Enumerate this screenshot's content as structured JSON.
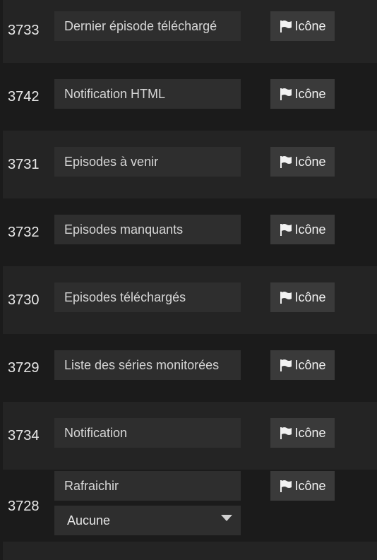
{
  "button_label": "Icône",
  "rows": [
    {
      "id": "3733",
      "name": "Dernier épisode téléchargé"
    },
    {
      "id": "3742",
      "name": "Notification HTML"
    },
    {
      "id": "3731",
      "name": "Episodes à venir"
    },
    {
      "id": "3732",
      "name": "Episodes manquants"
    },
    {
      "id": "3730",
      "name": "Episodes téléchargés"
    },
    {
      "id": "3729",
      "name": "Liste des séries monitorées"
    },
    {
      "id": "3734",
      "name": "Notification"
    },
    {
      "id": "3728",
      "name": "Rafraichir",
      "select_value": "Aucune"
    }
  ],
  "icons": {
    "button_icon": "flag-icon",
    "select_caret": "chevron-down-icon"
  },
  "colors": {
    "background": "#1b1b1b",
    "row_alt": "#242424",
    "input_bg": "#2e2e2e",
    "button_bg": "#3a3a3a"
  }
}
